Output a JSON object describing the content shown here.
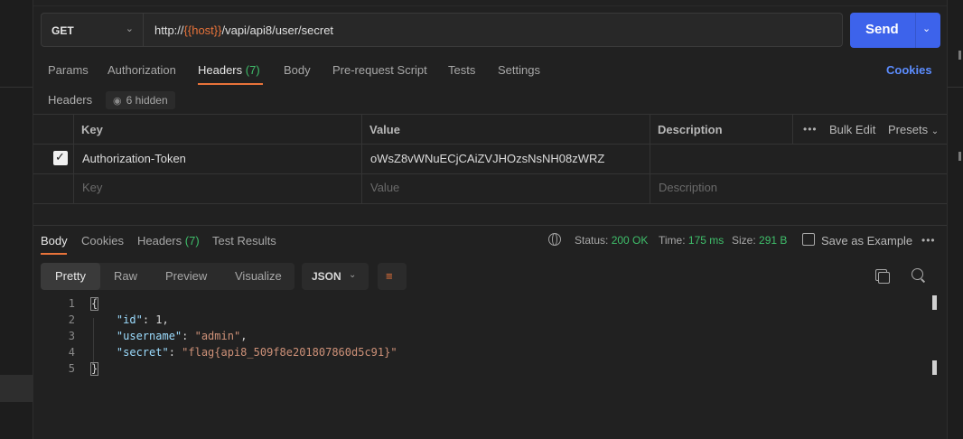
{
  "request": {
    "method": "GET",
    "url_prefix": "http://",
    "url_var": "{{host}}",
    "url_suffix": "/vapi/api8/user/secret",
    "send_label": "Send"
  },
  "request_tabs": [
    {
      "label": "Params"
    },
    {
      "label": "Authorization"
    },
    {
      "label": "Headers",
      "count": "(7)"
    },
    {
      "label": "Body"
    },
    {
      "label": "Pre-request Script"
    },
    {
      "label": "Tests"
    },
    {
      "label": "Settings"
    }
  ],
  "cookies_link": "Cookies",
  "headers_section": {
    "label": "Headers",
    "hidden_badge": "6 hidden",
    "columns": {
      "key": "Key",
      "value": "Value",
      "description": "Description"
    },
    "bulk_edit": "Bulk Edit",
    "presets": "Presets",
    "rows": [
      {
        "key": "Authorization-Token",
        "value": "oWsZ8vWNuECjCAiZVJHOzsNsNH08zWRZ",
        "description": ""
      }
    ],
    "placeholder": {
      "key": "Key",
      "value": "Value",
      "description": "Description"
    }
  },
  "response_tabs": [
    {
      "label": "Body"
    },
    {
      "label": "Cookies"
    },
    {
      "label": "Headers",
      "count": "(7)"
    },
    {
      "label": "Test Results"
    }
  ],
  "response_status": {
    "status_label": "Status:",
    "status_value": "200 OK",
    "time_label": "Time:",
    "time_value": "175 ms",
    "size_label": "Size:",
    "size_value": "291 B",
    "save_example": "Save as Example"
  },
  "view_modes": [
    "Pretty",
    "Raw",
    "Preview",
    "Visualize"
  ],
  "language": "JSON",
  "code": {
    "line_numbers": [
      "1",
      "2",
      "3",
      "4",
      "5"
    ],
    "open_brace": "{",
    "close_brace": "}",
    "id_key": "\"id\"",
    "id_value": "1",
    "username_key": "\"username\"",
    "username_value": "\"admin\"",
    "secret_key": "\"secret\"",
    "secret_value": "\"flag{api8_509f8e201807860d5c91}\""
  }
}
